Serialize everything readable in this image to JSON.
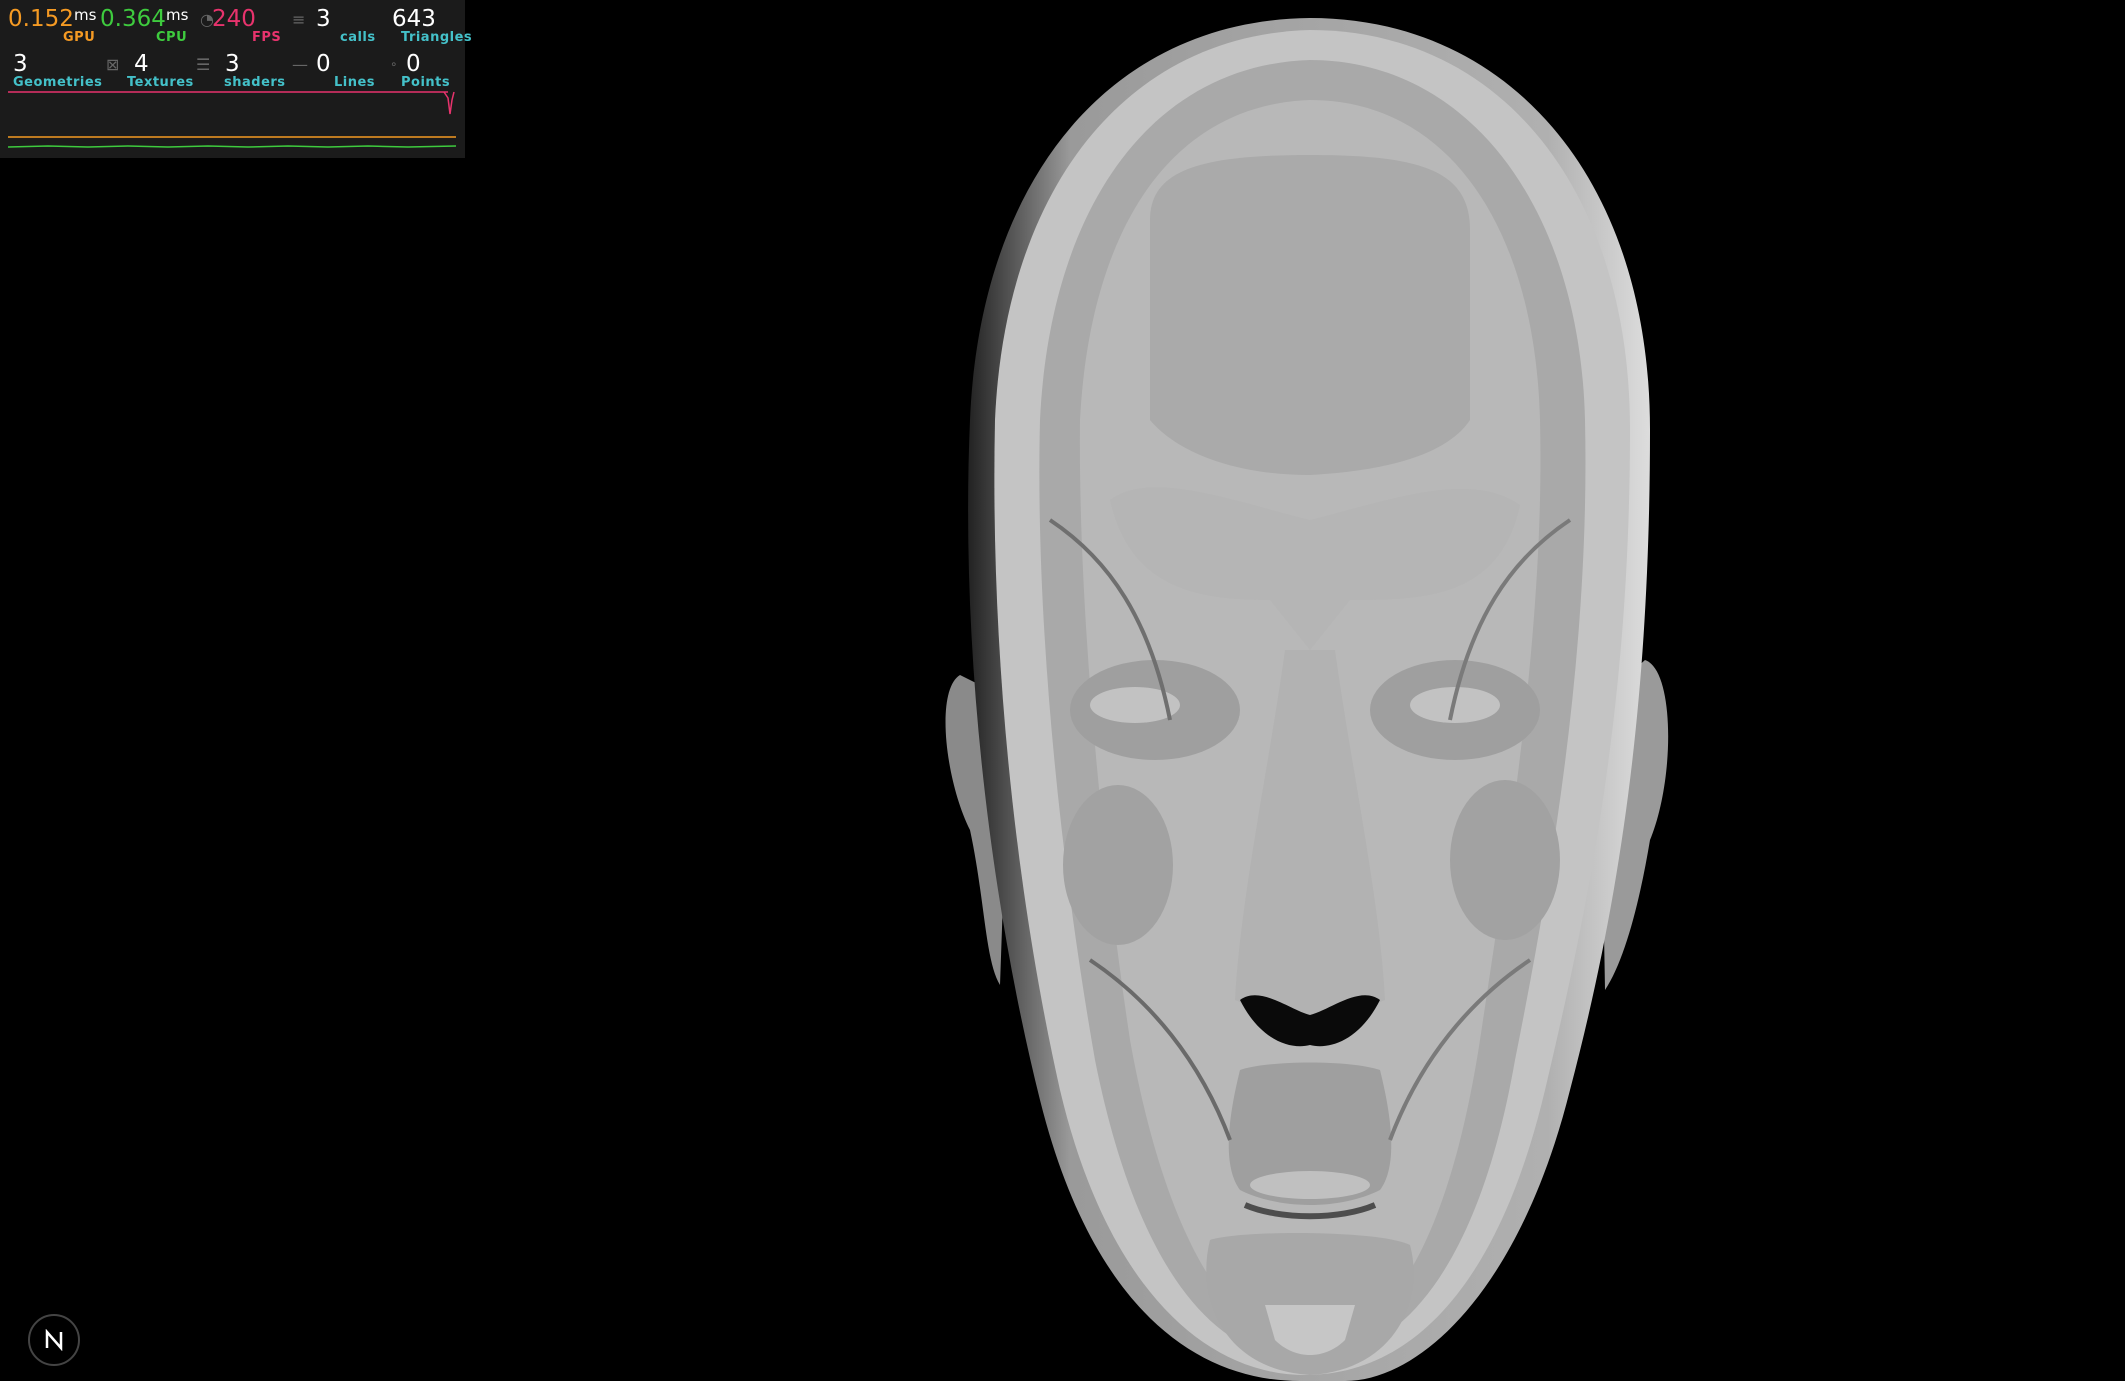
{
  "stats": {
    "gpu": {
      "value": "0.152",
      "unit": "ms",
      "label": "GPU",
      "color": "#f59a23"
    },
    "cpu": {
      "value": "0.364",
      "unit": "ms",
      "label": "CPU",
      "color": "#3ecb3e"
    },
    "fps": {
      "value": "240",
      "label": "FPS",
      "color": "#e8336d"
    },
    "calls": {
      "value": "3",
      "label": "calls",
      "color": "#44c1c9"
    },
    "triangles": {
      "value": "643",
      "label": "Triangles",
      "color": "#44c1c9"
    },
    "geometries": {
      "value": "3",
      "label": "Geometries",
      "color": "#44c1c9"
    },
    "textures": {
      "value": "4",
      "label": "Textures",
      "color": "#44c1c9"
    },
    "shaders": {
      "value": "3",
      "label": "shaders",
      "color": "#44c1c9"
    },
    "lines": {
      "value": "0",
      "label": "Lines",
      "color": "#44c1c9"
    },
    "points": {
      "value": "0",
      "label": "Points",
      "color": "#44c1c9"
    }
  },
  "nav_button": {
    "label": "N",
    "icon": "next-logo-icon"
  }
}
